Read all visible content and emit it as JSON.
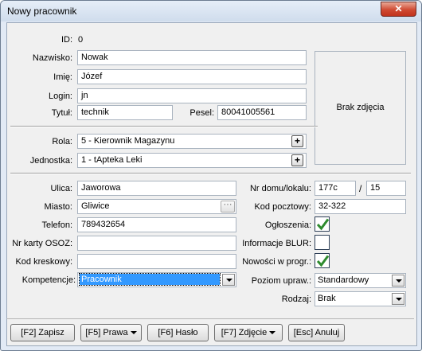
{
  "window": {
    "title": "Nowy pracownik",
    "close_label": "✕"
  },
  "id_label": "ID:",
  "id_value": "0",
  "fields": {
    "nazwisko": {
      "label": "Nazwisko:",
      "value": "Nowak"
    },
    "imie": {
      "label": "Imię:",
      "value": "Józef"
    },
    "login": {
      "label": "Login:",
      "value": "jn"
    },
    "tytul": {
      "label": "Tytuł:",
      "value": "technik"
    },
    "pesel": {
      "label": "Pesel:",
      "value": "80041005561"
    },
    "rola": {
      "label": "Rola:",
      "value": "5 - Kierownik Magazynu"
    },
    "jednostka": {
      "label": "Jednostka:",
      "value": "1 - tApteka Leki"
    },
    "ulica": {
      "label": "Ulica:",
      "value": "Jaworowa"
    },
    "miasto": {
      "label": "Miasto:",
      "value": "Gliwice"
    },
    "telefon": {
      "label": "Telefon:",
      "value": "789432654"
    },
    "nr_karty": {
      "label": "Nr karty OSOZ:",
      "value": ""
    },
    "kod_kreskowy": {
      "label": "Kod kreskowy:",
      "value": ""
    },
    "kompetencje": {
      "label": "Kompetencje:",
      "value": "Pracownik"
    },
    "nr_domu": {
      "label": "Nr domu/lokalu:",
      "value": "177c",
      "separator": "/",
      "lokal": "15"
    },
    "kod_pocztowy": {
      "label": "Kod pocztowy:",
      "value": "32-322"
    },
    "ogloszenia": {
      "label": "Ogłoszenia:",
      "checked": true
    },
    "informacje_blur": {
      "label": "Informacje BLUR:",
      "checked": false
    },
    "nowosci": {
      "label": "Nowości w progr.:",
      "checked": true
    },
    "poziom": {
      "label": "Poziom upraw.:",
      "value": "Standardowy"
    },
    "rodzaj": {
      "label": "Rodzaj:",
      "value": "Brak"
    }
  },
  "photo_placeholder": "Brak zdjęcia",
  "buttons": {
    "zapisz": "[F2] Zapisz",
    "prawa": "[F5] Prawa",
    "haslo": "[F6] Hasło",
    "zdjecie": "[F7] Zdjęcie",
    "anuluj": "[Esc] Anuluj"
  },
  "colors": {
    "check": "#2e8b2e",
    "selection": "#3399ff",
    "close": "#c7402b"
  }
}
